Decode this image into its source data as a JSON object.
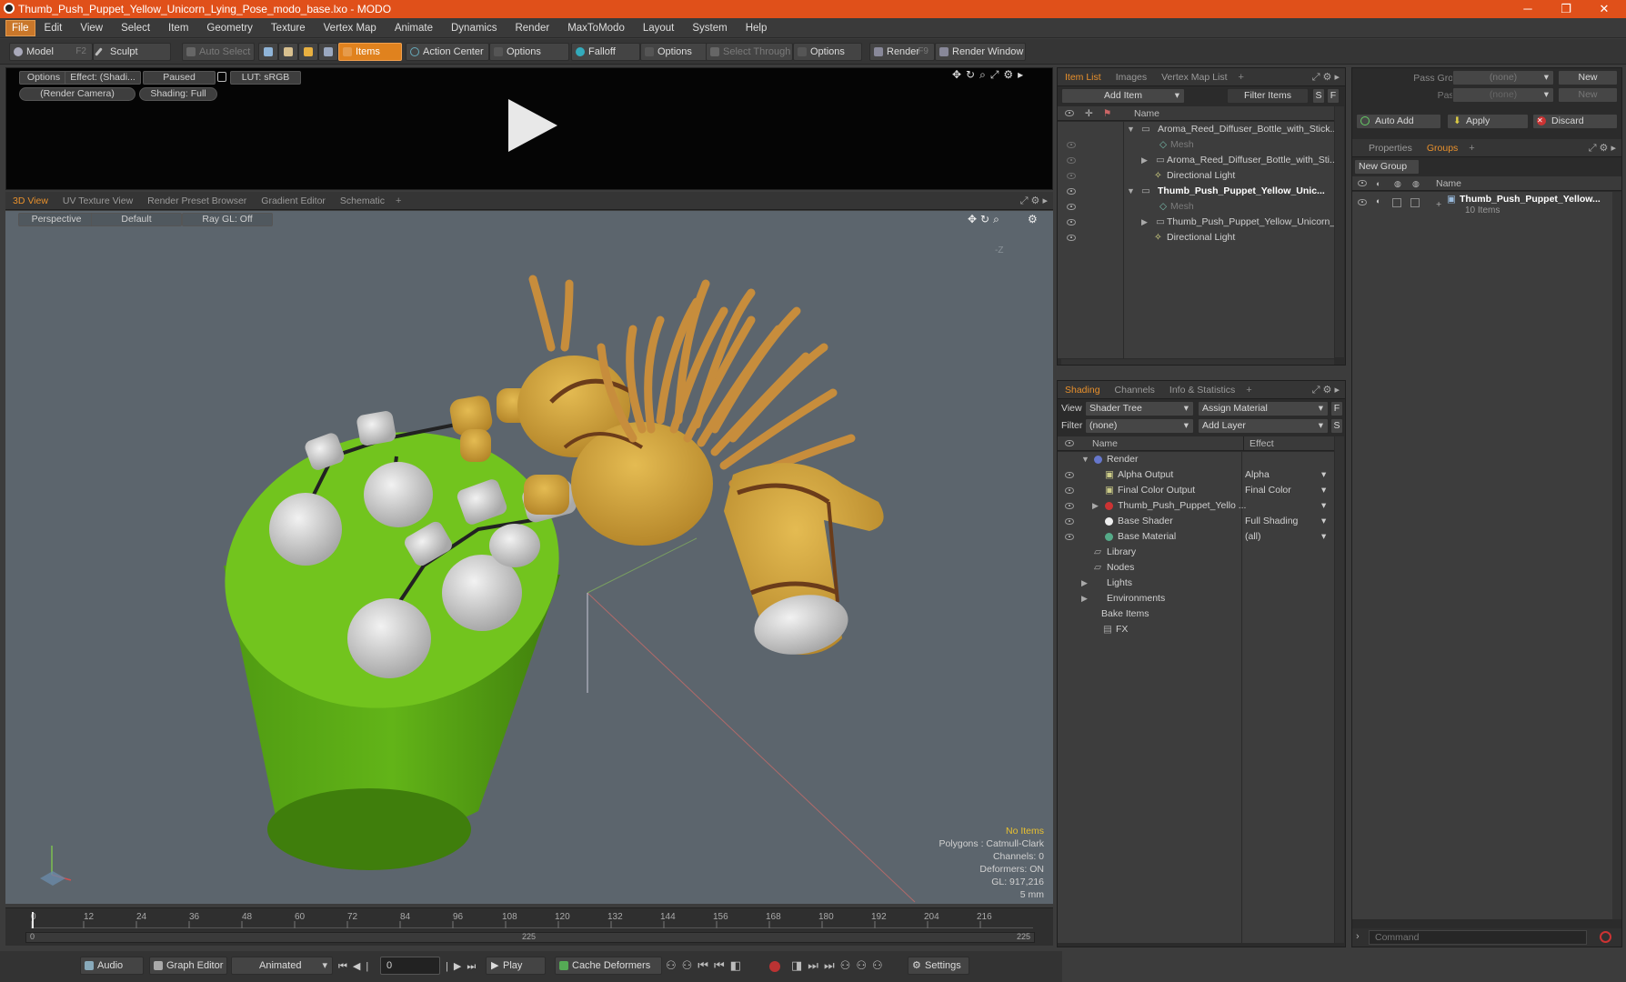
{
  "window": {
    "title": "Thumb_Push_Puppet_Yellow_Unicorn_Lying_Pose_modo_base.lxo - MODO"
  },
  "menu": [
    "File",
    "Edit",
    "View",
    "Select",
    "Item",
    "Geometry",
    "Texture",
    "Vertex Map",
    "Animate",
    "Dynamics",
    "Render",
    "MaxToModo",
    "Layout",
    "System",
    "Help"
  ],
  "toolbar": {
    "model": "Model",
    "model_key": "F2",
    "sculpt": "Sculpt",
    "auto_select": "Auto Select",
    "items": "Items",
    "action_center": "Action Center",
    "options1": "Options",
    "falloff": "Falloff",
    "options2": "Options",
    "select_through": "Select Through",
    "options3": "Options",
    "render": "Render",
    "render_key": "F9",
    "render_window": "Render Window"
  },
  "render_preview": {
    "options": "Options",
    "effect": "Effect: (Shadi...",
    "paused": "Paused",
    "lut": "LUT: sRGB",
    "camera": "(Render Camera)",
    "shading": "Shading: Full"
  },
  "viewport_tabs": [
    "3D View",
    "UV Texture View",
    "Render Preset Browser",
    "Gradient Editor",
    "Schematic"
  ],
  "viewport": {
    "perspective": "Perspective",
    "default": "Default",
    "raygl": "Ray GL: Off",
    "axis_z": "-Z",
    "stats": {
      "no_items": "No Items",
      "polygons": "Polygons : Catmull-Clark",
      "channels": "Channels: 0",
      "deformers": "Deformers: ON",
      "gl": "GL: 917,216",
      "unit": "5 mm"
    }
  },
  "timeline": {
    "ticks": [
      "0",
      "12",
      "24",
      "36",
      "48",
      "60",
      "72",
      "84",
      "96",
      "108",
      "120",
      "132",
      "144",
      "156",
      "168",
      "180",
      "192",
      "204",
      "216"
    ],
    "start": "0",
    "mid": "225",
    "end": "225"
  },
  "bottombar": {
    "audio": "Audio",
    "graph_editor": "Graph Editor",
    "animated": "Animated",
    "frame": "0",
    "play": "Play",
    "cache_deformers": "Cache Deformers",
    "settings": "Settings"
  },
  "item_list": {
    "tabs": [
      "Item List",
      "Images",
      "Vertex Map List"
    ],
    "add_item": "Add Item",
    "filter_items": "Filter Items",
    "col_name": "Name",
    "rows": [
      {
        "label": "Aroma_Reed_Diffuser_Bottle_with_Stick...",
        "indent": 0,
        "bold": false
      },
      {
        "label": "Mesh",
        "indent": 1,
        "bold": false,
        "dim": true
      },
      {
        "label": "Aroma_Reed_Diffuser_Bottle_with_Sti...",
        "indent": 1,
        "bold": false
      },
      {
        "label": "Directional Light",
        "indent": 1,
        "bold": false
      },
      {
        "label": "Thumb_Push_Puppet_Yellow_Unic...",
        "indent": 0,
        "bold": true
      },
      {
        "label": "Mesh",
        "indent": 1,
        "bold": false,
        "dim": true
      },
      {
        "label": "Thumb_Push_Puppet_Yellow_Unicorn_...",
        "indent": 1,
        "bold": false
      },
      {
        "label": "Directional Light",
        "indent": 1,
        "bold": false
      }
    ]
  },
  "shading": {
    "tabs": [
      "Shading",
      "Channels",
      "Info & Statistics"
    ],
    "view_label": "View",
    "view_value": "Shader Tree",
    "assign_material": "Assign Material",
    "filter_label": "Filter",
    "filter_value": "(none)",
    "add_layer": "Add Layer",
    "col_name": "Name",
    "col_effect": "Effect",
    "rows": [
      {
        "label": "Render",
        "effect": ""
      },
      {
        "label": "Alpha Output",
        "effect": "Alpha"
      },
      {
        "label": "Final Color Output",
        "effect": "Final Color"
      },
      {
        "label": "Thumb_Push_Puppet_Yello ...",
        "effect": ""
      },
      {
        "label": "Base Shader",
        "effect": "Full Shading"
      },
      {
        "label": "Base Material",
        "effect": "(all)"
      },
      {
        "label": "Library",
        "effect": ""
      },
      {
        "label": "Nodes",
        "effect": ""
      },
      {
        "label": "Lights",
        "effect": ""
      },
      {
        "label": "Environments",
        "effect": ""
      },
      {
        "label": "Bake Items",
        "effect": ""
      },
      {
        "label": "FX",
        "effect": ""
      }
    ]
  },
  "groups": {
    "pass_groups": "Pass Groups",
    "passes": "Passes",
    "none1": "(none)",
    "none2": "(none)",
    "new1": "New",
    "new2": "New",
    "auto_add": "Auto Add",
    "apply": "Apply",
    "discard": "Discard",
    "tabs": [
      "Properties",
      "Groups"
    ],
    "new_group": "New Group",
    "col_name": "Name",
    "item": "Thumb_Push_Puppet_Yellow...",
    "item_sub": "10 Items"
  },
  "command": {
    "placeholder": "Command"
  },
  "colors": {
    "accent": "#e0821e",
    "titlebar": "#e0501a",
    "viewport": "#5c656d",
    "cake": "#6bbf1c",
    "puppet": "#d4a640"
  }
}
